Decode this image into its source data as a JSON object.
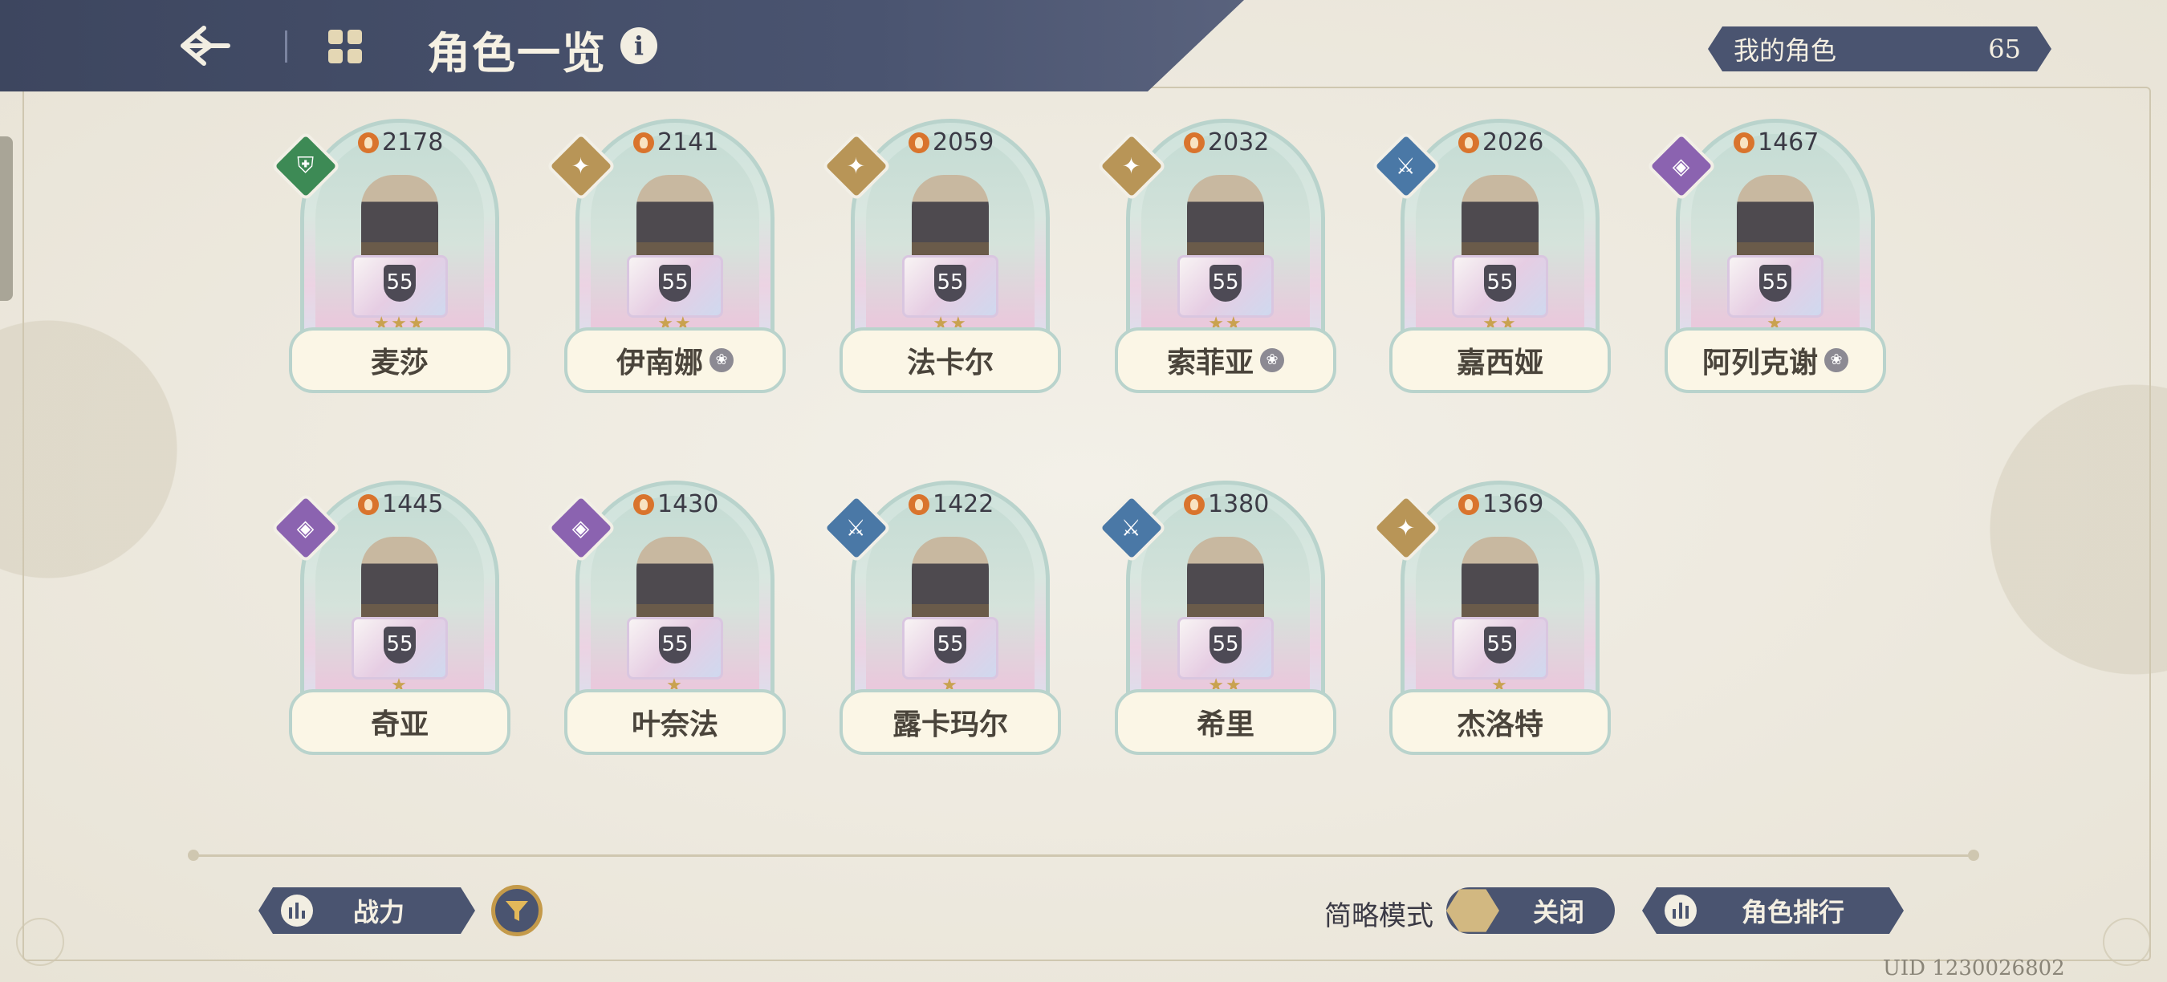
{
  "header": {
    "title": "角色一览",
    "info_icon": "i"
  },
  "my_characters": {
    "label": "我的角色",
    "count": "65"
  },
  "characters": [
    {
      "name": "麦莎",
      "power": "2178",
      "level": "55",
      "stars": "★★★",
      "element": "shield-icon",
      "element_color": "#3d8a55",
      "awakened": false
    },
    {
      "name": "伊南娜",
      "power": "2141",
      "level": "55",
      "stars": "★★",
      "element": "compass-star-icon",
      "element_color": "#b89557",
      "awakened": true
    },
    {
      "name": "法卡尔",
      "power": "2059",
      "level": "55",
      "stars": "★★",
      "element": "compass-star-icon",
      "element_color": "#b89557",
      "awakened": false
    },
    {
      "name": "索菲亚",
      "power": "2032",
      "level": "55",
      "stars": "★★",
      "element": "compass-star-icon",
      "element_color": "#b89557",
      "awakened": true
    },
    {
      "name": "嘉西娅",
      "power": "2026",
      "level": "55",
      "stars": "★★",
      "element": "crossed-blades-icon",
      "element_color": "#4a78a6",
      "awakened": false
    },
    {
      "name": "阿列克谢",
      "power": "1467",
      "level": "55",
      "stars": "★",
      "element": "arcane-sigil-icon",
      "element_color": "#8b63b0",
      "awakened": true
    },
    {
      "name": "奇亚",
      "power": "1445",
      "level": "55",
      "stars": "★",
      "element": "arcane-sigil-icon",
      "element_color": "#8b63b0",
      "awakened": false
    },
    {
      "name": "叶奈法",
      "power": "1430",
      "level": "55",
      "stars": "★",
      "element": "arcane-sigil-icon",
      "element_color": "#8b63b0",
      "awakened": false
    },
    {
      "name": "露卡玛尔",
      "power": "1422",
      "level": "55",
      "stars": "★",
      "element": "crossed-blades-icon",
      "element_color": "#4a78a6",
      "awakened": false
    },
    {
      "name": "希里",
      "power": "1380",
      "level": "55",
      "stars": "★★",
      "element": "crossed-blades-icon",
      "element_color": "#4a78a6",
      "awakened": false
    },
    {
      "name": "杰洛特",
      "power": "1369",
      "level": "55",
      "stars": "★",
      "element": "compass-star-icon",
      "element_color": "#b89557",
      "awakened": false
    }
  ],
  "footer": {
    "sort_label": "战力",
    "simple_mode_label": "简略模式",
    "simple_mode_value": "关闭",
    "ranking_label": "角色排行",
    "uid": "UID 1230026802"
  },
  "colors": {
    "header_bg": "#3d465f",
    "accent_gold": "#c49a4a",
    "page_bg": "#ece8dd"
  }
}
